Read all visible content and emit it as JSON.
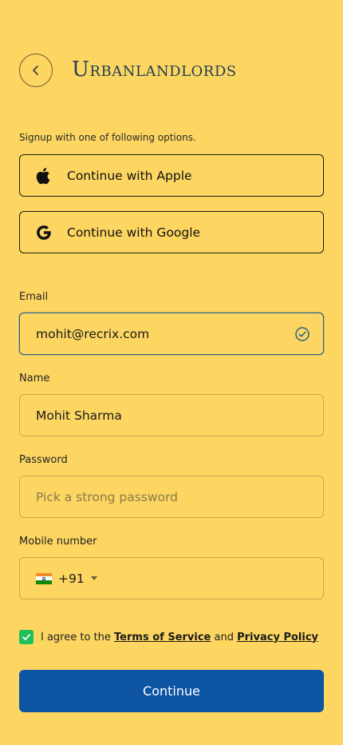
{
  "header": {
    "brand": "Urbanlandlords",
    "back_icon": "chevron-left-icon"
  },
  "signup": {
    "subtitle": "Signup with one of following options.",
    "apple_label": "Continue with Apple",
    "google_label": "Continue with Google"
  },
  "form": {
    "email": {
      "label": "Email",
      "value": "mohit@recrix.com",
      "status_icon": "check-circle-icon"
    },
    "name": {
      "label": "Name",
      "value": "Mohit Sharma"
    },
    "password": {
      "label": "Password",
      "placeholder": "Pick a strong password"
    },
    "mobile": {
      "label": "Mobile number",
      "country_code": "+91",
      "flag": "india-flag-icon"
    }
  },
  "agreement": {
    "checked": true,
    "prefix": "I agree to the ",
    "terms": "Terms of Service",
    "middle": " and ",
    "privacy": "Privacy Policy"
  },
  "continue_label": "Continue",
  "colors": {
    "background": "#FDD662",
    "primary": "#0D55A3",
    "check": "#1FBF5A",
    "brand_text": "#1F3F52"
  }
}
